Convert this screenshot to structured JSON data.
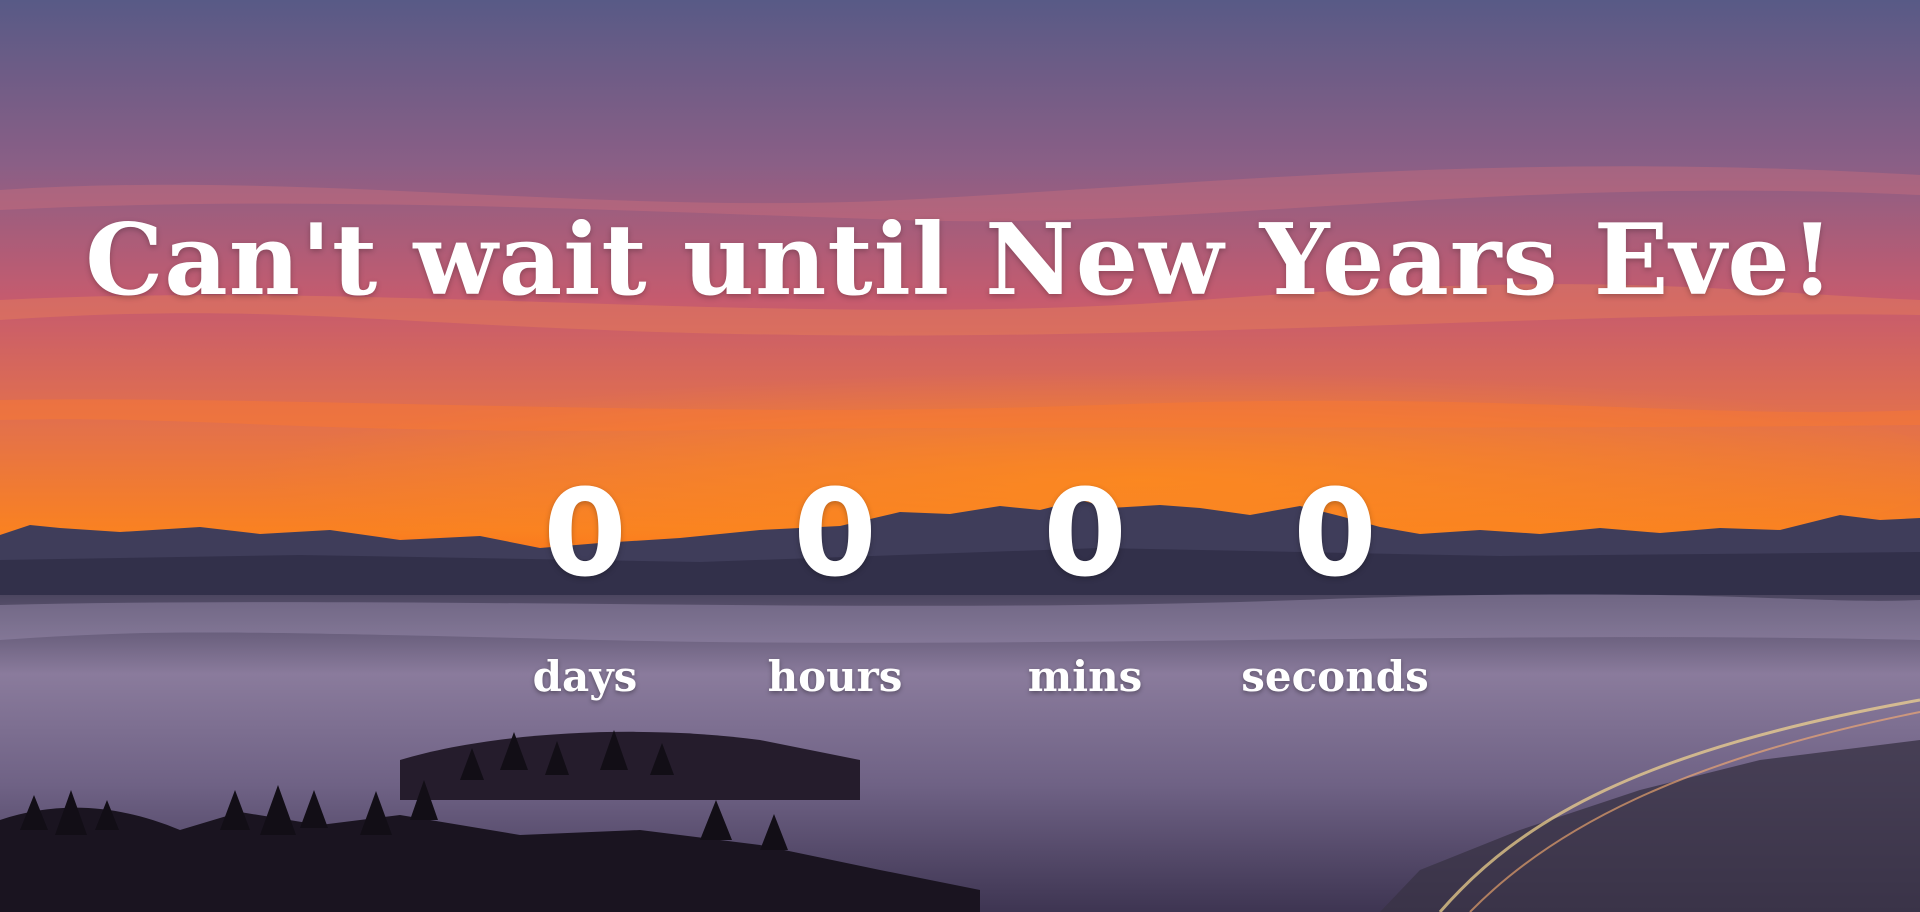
{
  "headline": "Can't wait until New Years Eve!",
  "countdown": [
    {
      "value": "0",
      "label": "days"
    },
    {
      "value": "0",
      "label": "hours"
    },
    {
      "value": "0",
      "label": "mins"
    },
    {
      "value": "0",
      "label": "seconds"
    }
  ],
  "colors": {
    "sky_top": "#5a5a86",
    "sky_mid": "#c9566c",
    "sky_glow": "#ff7a14",
    "mountains": "#3e3c58",
    "fog": "#7a6a8e",
    "foreground": "#1c1622"
  }
}
